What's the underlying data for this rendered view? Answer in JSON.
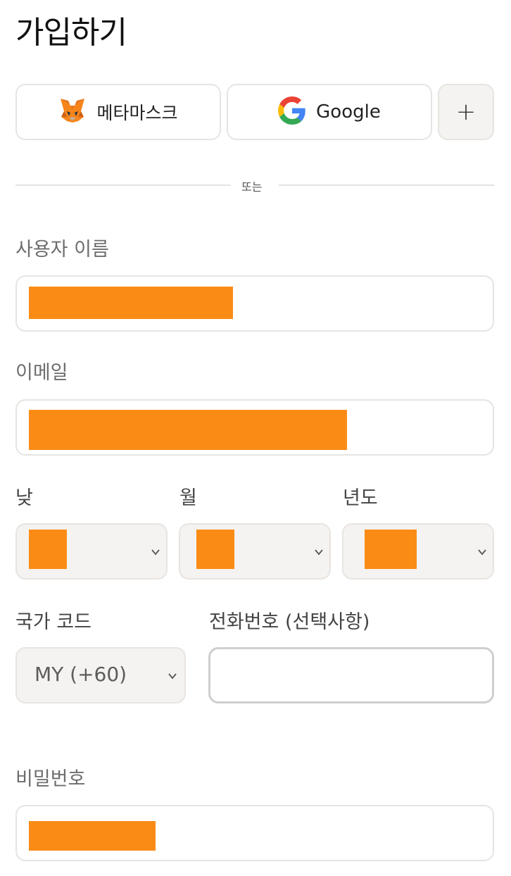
{
  "page": {
    "title": "가입하기"
  },
  "social": {
    "metamask_label": "메타마스크",
    "google_label": "Google",
    "more_label": "+"
  },
  "divider": {
    "or_text": "또는"
  },
  "form": {
    "username_label": "사용자 이름",
    "email_label": "이메일",
    "day_label": "낮",
    "month_label": "월",
    "year_label": "년도",
    "country_code_label": "국가 코드",
    "country_code_value": "MY (+60)",
    "phone_label": "전화번호 (선택사항)",
    "password_label": "비밀번호"
  },
  "colors": {
    "redaction": "#fa8c16",
    "border": "#e7e4e1",
    "select_bg": "#f5f3f1"
  },
  "icons": {
    "metamask": "metamask-fox-icon",
    "google": "google-g-icon",
    "plus": "plus-icon",
    "chevron": "chevron-down-icon"
  }
}
